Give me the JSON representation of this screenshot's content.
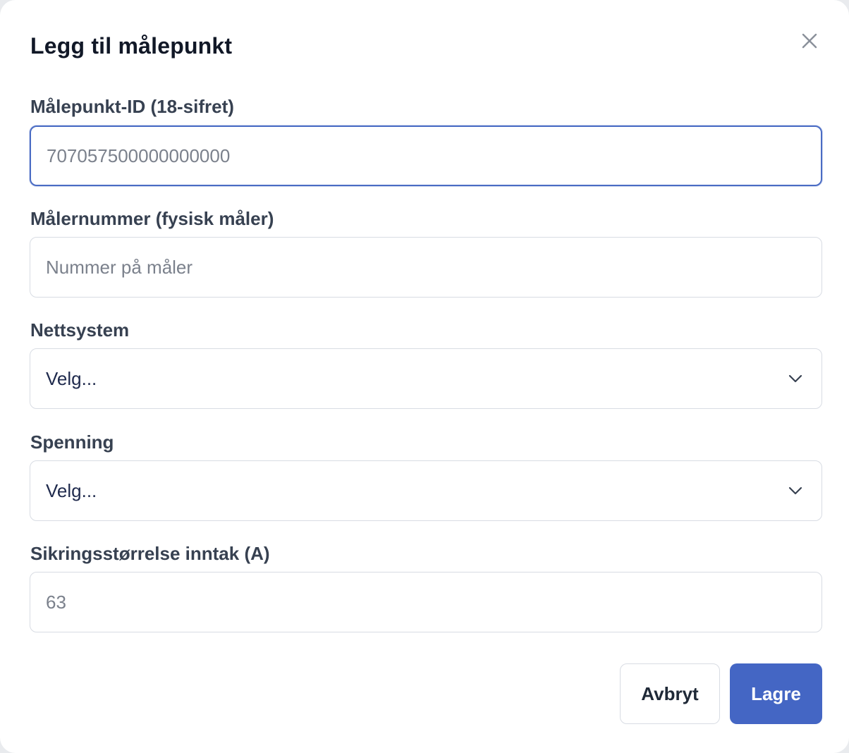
{
  "dialog": {
    "title": "Legg til målepunkt",
    "close_icon": "close-icon"
  },
  "fields": {
    "metering_point_id": {
      "label": "Målepunkt-ID (18-sifret)",
      "placeholder": "707057500000000000",
      "value": ""
    },
    "meter_number": {
      "label": "Målernummer (fysisk måler)",
      "placeholder": "Nummer på måler",
      "value": ""
    },
    "grid_system": {
      "label": "Nettsystem",
      "selected": "Velg...",
      "icon": "chevron-down-icon"
    },
    "voltage": {
      "label": "Spenning",
      "selected": "Velg...",
      "icon": "chevron-down-icon"
    },
    "fuse_size": {
      "label": "Sikringsstørrelse inntak (A)",
      "placeholder": "63",
      "value": ""
    }
  },
  "actions": {
    "cancel_label": "Avbryt",
    "save_label": "Lagre"
  },
  "colors": {
    "accent": "#4466c4",
    "focus_border": "#4a6cc4",
    "title": "#111827",
    "label": "#374151",
    "border": "#d8dce3"
  }
}
